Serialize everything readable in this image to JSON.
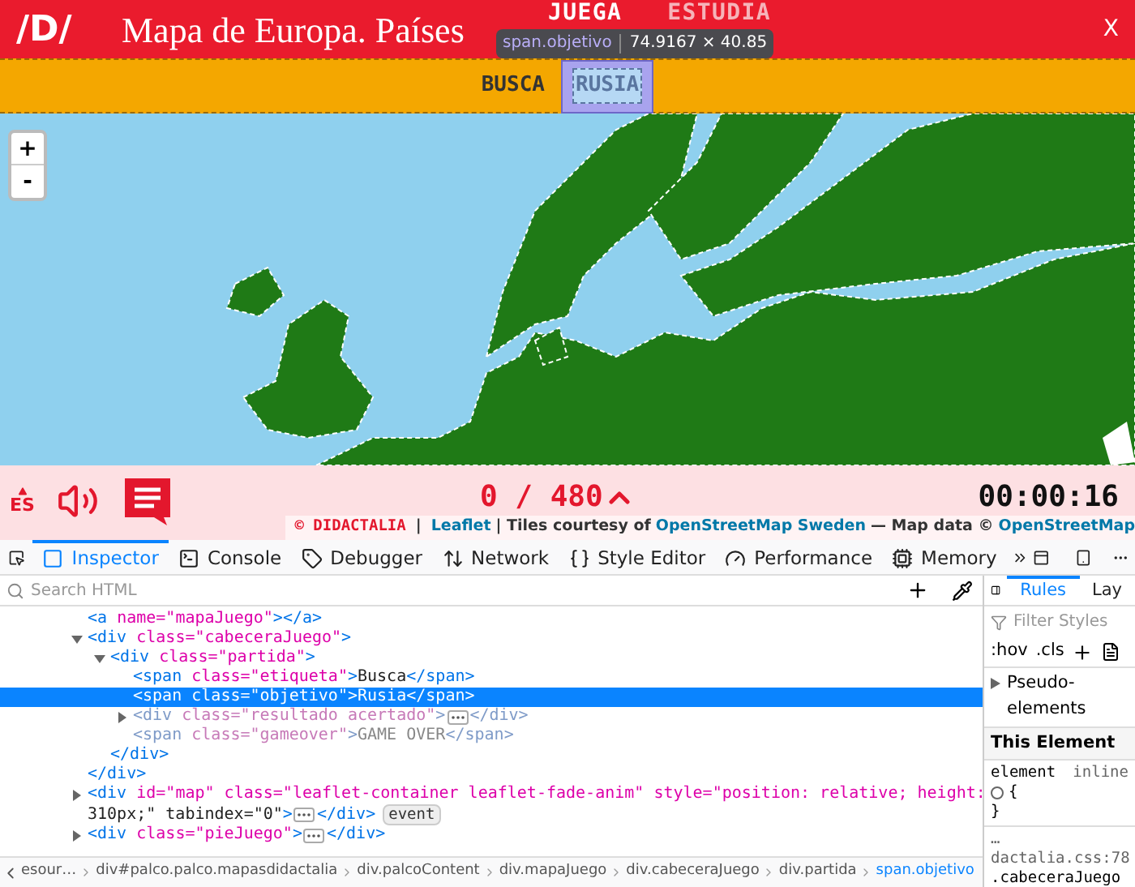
{
  "header": {
    "logo": "/D/",
    "title": "Mapa de Europa. Países",
    "nav": [
      {
        "label": "JUEGA",
        "selected": true
      },
      {
        "label": "ESTUDIA",
        "selected": false
      }
    ],
    "close": "X"
  },
  "inspector_tooltip": {
    "selector": "span.objetivo",
    "size": "74.9167 × 40.85"
  },
  "game_bar": {
    "label": "BUSCA",
    "target": "RUSIA"
  },
  "map": {
    "zoom_in": "+",
    "zoom_out": "-"
  },
  "footer_bar": {
    "language": "ES",
    "score": "0 / 480",
    "timer": "00:00:16"
  },
  "attribution": {
    "brand": "© DIDACTALIA",
    "separator": "|",
    "leaflet": "Leaflet",
    "text_1": "| Tiles courtesy of",
    "osm_sweden": "OpenStreetMap Sweden",
    "text_2": "— Map data ©",
    "osm": "OpenStreetMap"
  },
  "devtools": {
    "tabs": [
      {
        "label": "Inspector",
        "selected": true
      },
      {
        "label": "Console",
        "selected": false
      },
      {
        "label": "Debugger",
        "selected": false
      },
      {
        "label": "Network",
        "selected": false
      },
      {
        "label": "Style Editor",
        "selected": false
      },
      {
        "label": "Performance",
        "selected": false
      },
      {
        "label": "Memory",
        "selected": false
      }
    ],
    "search_placeholder": "Search HTML",
    "tree_lines": [
      {
        "open": "<a name=\"mapaJuego\"></a>",
        "selected": false,
        "dimmed": false
      },
      {
        "open": "<div class=\"cabeceraJuego\">",
        "expanded": true,
        "selected": false,
        "dimmed": false,
        "closing": "</div>",
        "children": [
          {
            "open": "<div class=\"partida\">",
            "expanded": true,
            "selected": false,
            "dimmed": false,
            "closing": "</div>",
            "children": [
              {
                "open": "<span class=\"etiqueta\">Busca</span>",
                "selected": false,
                "dimmed": false
              },
              {
                "open": "<span class=\"objetivo\">Rusia</span>",
                "selected": true,
                "dimmed": false
              },
              {
                "open": "<div class=\"resultado acertado\">",
                "close": "</div>",
                "expanded": false,
                "selected": false,
                "dimmed": true
              },
              {
                "open": "<span class=\"gameover\">GAME OVER</span>",
                "selected": false,
                "dimmed": true
              }
            ]
          }
        ]
      },
      {
        "open": "<div id=\"map\" class=\"leaflet-container leaflet-fade-anim\" style=\"position: relative; height:",
        "open_wrap": "310px;\" tabindex=\"0\">",
        "close": "</div>",
        "expanded": false,
        "selected": false,
        "dimmed": false,
        "badge": "event"
      },
      {
        "open": "<div class=\"pieJuego\">",
        "close": "</div>",
        "expanded": false,
        "selected": false,
        "dimmed": false
      }
    ],
    "breadcrumbs": [
      {
        "label": "esour…",
        "selected": false
      },
      {
        "label": "div#palco.palco.mapasdidactalia",
        "selected": false
      },
      {
        "label": "div.palcoContent",
        "selected": false
      },
      {
        "label": "div.mapaJuego",
        "selected": false
      },
      {
        "label": "div.cabeceraJuego",
        "selected": false
      },
      {
        "label": "div.partida",
        "selected": false
      },
      {
        "label": "span.objetivo",
        "selected": true
      }
    ],
    "side_tabs": [
      {
        "label": "Rules",
        "selected": true
      },
      {
        "label": "Lay",
        "selected": false
      }
    ],
    "filter_placeholder": "Filter Styles",
    "hov": ":hov",
    "cls": ".cls",
    "pseudo_elements": "Pseudo-elements",
    "this_element": "This Element",
    "rule_selector": "element",
    "rule_source": "inline",
    "open_brace": "{",
    "close_brace": "}",
    "css_source": "…dactalia.css:78",
    "css_selector": ".cabeceraJuego"
  }
}
